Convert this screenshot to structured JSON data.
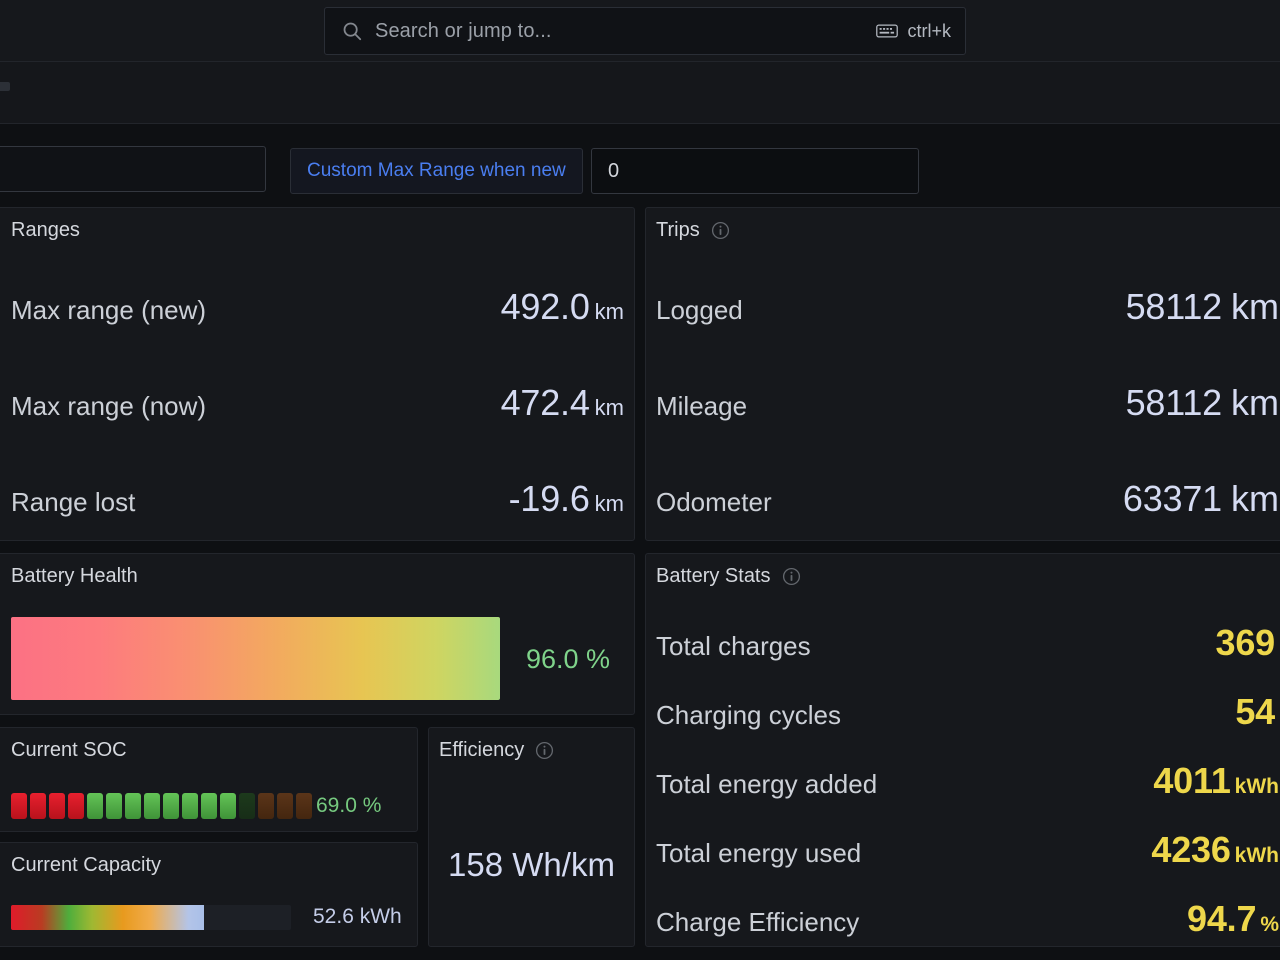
{
  "topbar": {
    "search_placeholder": "Search or jump to...",
    "shortcut": "ctrl+k",
    "search_icon": "search-icon",
    "keyboard_icon": "keyboard-icon"
  },
  "variables": {
    "custom_max_range_label": "Custom Max Range when new",
    "custom_max_range_value": "0"
  },
  "panels": {
    "ranges": {
      "title": "Ranges",
      "rows": [
        {
          "label": "Max range (new)",
          "value": "492.0",
          "unit": "km"
        },
        {
          "label": "Max range (now)",
          "value": "472.4",
          "unit": "km"
        },
        {
          "label": "Range lost",
          "value": "-19.6",
          "unit": "km"
        }
      ]
    },
    "trips": {
      "title": "Trips",
      "info_icon": "info-icon",
      "rows": [
        {
          "label": "Logged",
          "value": "58112",
          "unit": "km"
        },
        {
          "label": "Mileage",
          "value": "58112",
          "unit": "km"
        },
        {
          "label": "Odometer",
          "value": "63371",
          "unit": "km"
        }
      ]
    },
    "battery_health": {
      "title": "Battery Health",
      "value": "96.0 %",
      "percent": 96.0,
      "value_color": "#7fd38a"
    },
    "current_soc": {
      "title": "Current SOC",
      "value": "69.0 %",
      "percent": 69.0,
      "value_color": "#76c97f",
      "segments": [
        "red",
        "red",
        "red",
        "red",
        "green",
        "green",
        "green",
        "green",
        "green",
        "green",
        "green",
        "green",
        "dgreen",
        "dbrown",
        "dbrown",
        "dbrown"
      ]
    },
    "current_capacity": {
      "title": "Current Capacity",
      "value": "52.6 kWh",
      "fill_percent": 69,
      "value_color": "#c4cde8"
    },
    "efficiency": {
      "title": "Efficiency",
      "info_icon": "info-icon",
      "value": "158 Wh/km"
    },
    "battery_stats": {
      "title": "Battery Stats",
      "info_icon": "info-icon",
      "rows": [
        {
          "label": "Total charges",
          "value": "369",
          "unit": ""
        },
        {
          "label": "Charging cycles",
          "value": "54",
          "unit": ""
        },
        {
          "label": "Total energy added",
          "value": "4011",
          "unit": "kWh"
        },
        {
          "label": "Total energy used",
          "value": "4236",
          "unit": "kWh"
        },
        {
          "label": "Charge Efficiency",
          "value": "94.7",
          "unit": "%"
        }
      ]
    }
  },
  "colors": {
    "accent_blue": "#4a7ef0",
    "value_blue": "#d5dbf2",
    "value_yellow": "#eed74b",
    "value_green": "#7fd38a",
    "page_bg": "#0e1013",
    "panel_bg": "#16181c"
  }
}
